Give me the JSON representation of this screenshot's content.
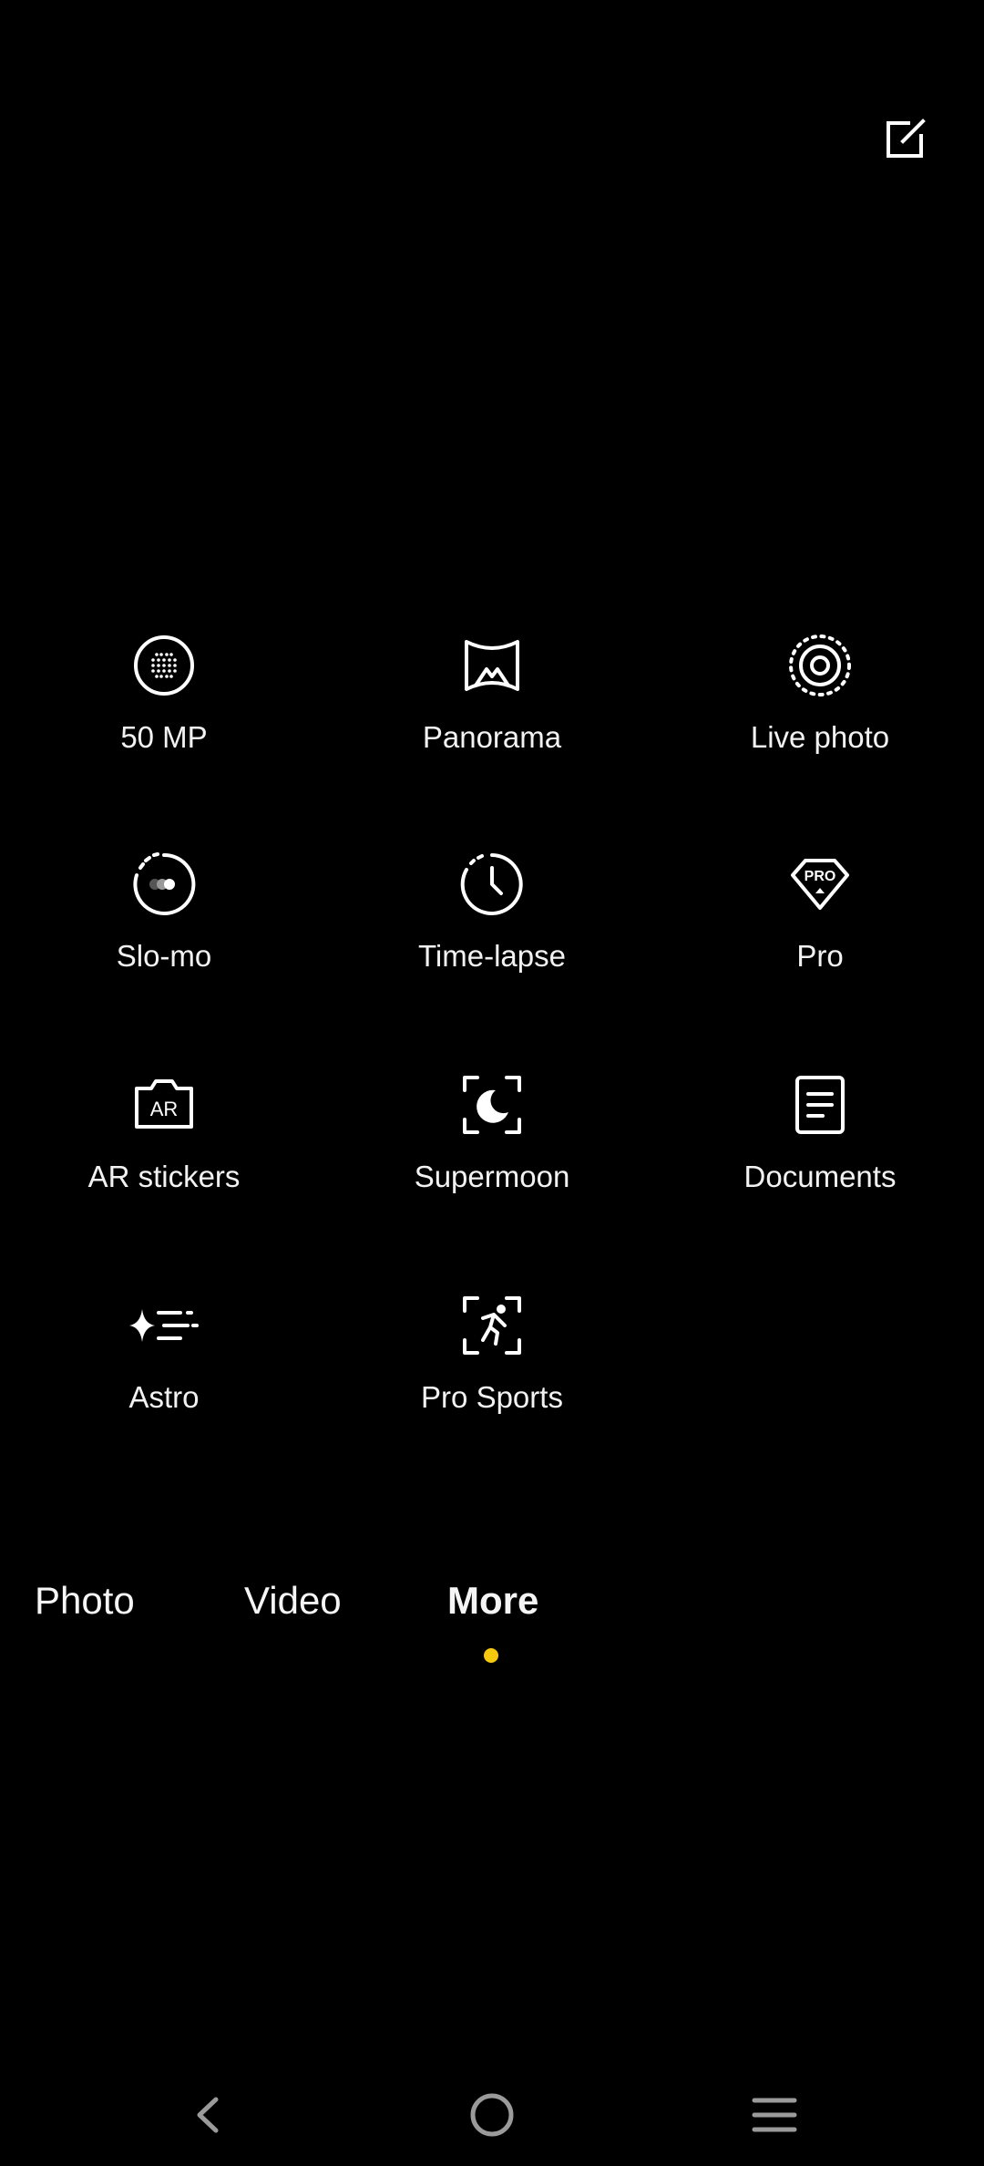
{
  "toolbar": {
    "edit_icon": "edit-square-icon"
  },
  "modes": [
    {
      "label": "50 MP",
      "icon": "50mp-dots-icon"
    },
    {
      "label": "Panorama",
      "icon": "panorama-icon"
    },
    {
      "label": "Live photo",
      "icon": "live-photo-icon"
    },
    {
      "label": "Slo-mo",
      "icon": "slo-mo-icon"
    },
    {
      "label": "Time-lapse",
      "icon": "time-lapse-clock-icon"
    },
    {
      "label": "Pro",
      "icon": "pro-badge-icon",
      "badge_text": "PRO"
    },
    {
      "label": "AR stickers",
      "icon": "ar-stickers-camera-icon",
      "badge_text": "AR"
    },
    {
      "label": "Supermoon",
      "icon": "supermoon-icon"
    },
    {
      "label": "Documents",
      "icon": "documents-icon"
    },
    {
      "label": "Astro",
      "icon": "astro-sparkle-icon"
    },
    {
      "label": "Pro Sports",
      "icon": "pro-sports-runner-icon"
    }
  ],
  "tabs": [
    {
      "label": "Photo",
      "active": false
    },
    {
      "label": "Video",
      "active": false
    },
    {
      "label": "More",
      "active": true
    }
  ],
  "colors": {
    "background": "#000000",
    "active_dot": "#f6c90e",
    "text": "#f2f2f2",
    "nav_icons": "#9a9a9a"
  },
  "navbar": {
    "back_icon": "back-chevron-icon",
    "home_icon": "home-circle-icon",
    "menu_icon": "recents-menu-icon"
  }
}
